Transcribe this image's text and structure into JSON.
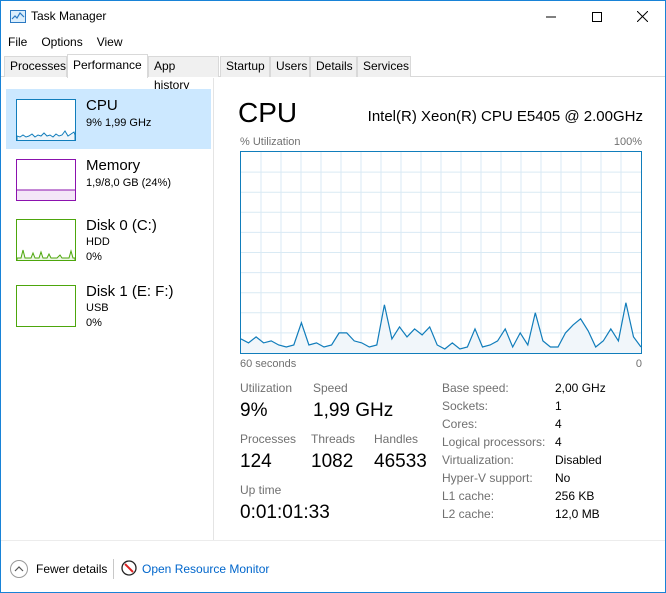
{
  "window": {
    "title": "Task Manager"
  },
  "menu": [
    "File",
    "Options",
    "View"
  ],
  "tabs": [
    "Processes",
    "Performance",
    "App history",
    "Startup",
    "Users",
    "Details",
    "Services"
  ],
  "sidebar": {
    "items": [
      {
        "name": "CPU",
        "line1": "9%  1,99 GHz",
        "line2": ""
      },
      {
        "name": "Memory",
        "line1": "1,9/8,0 GB (24%)",
        "line2": ""
      },
      {
        "name": "Disk 0 (C:)",
        "line1": "HDD",
        "line2": "0%"
      },
      {
        "name": "Disk 1 (E: F:)",
        "line1": "USB",
        "line2": "0%"
      }
    ]
  },
  "main": {
    "title": "CPU",
    "model": "Intel(R) Xeon(R) CPU E5405 @ 2.00GHz",
    "graph": {
      "y_label": "% Utilization",
      "y_max": "100%",
      "x_label_left": "60 seconds",
      "x_label_right": "0"
    },
    "stats": {
      "utilization_label": "Utilization",
      "utilization": "9%",
      "speed_label": "Speed",
      "speed": "1,99 GHz",
      "processes_label": "Processes",
      "processes": "124",
      "threads_label": "Threads",
      "threads": "1082",
      "handles_label": "Handles",
      "handles": "46533",
      "uptime_label": "Up time",
      "uptime": "0:01:01:33"
    },
    "details": [
      {
        "label": "Base speed:",
        "value": "2,00 GHz"
      },
      {
        "label": "Sockets:",
        "value": "1"
      },
      {
        "label": "Cores:",
        "value": "4"
      },
      {
        "label": "Logical processors:",
        "value": "4"
      },
      {
        "label": "Virtualization:",
        "value": "Disabled"
      },
      {
        "label": "Hyper-V support:",
        "value": "No"
      },
      {
        "label": "L1 cache:",
        "value": "256 KB"
      },
      {
        "label": "L2 cache:",
        "value": "12,0 MB"
      }
    ]
  },
  "footer": {
    "fewer_details": "Fewer details",
    "open_monitor": "Open Resource Monitor"
  },
  "chart_data": {
    "type": "area",
    "title": "",
    "ylim": [
      0,
      100
    ],
    "series": [
      {
        "values": [
          7,
          5,
          8,
          5,
          6,
          4,
          3,
          4,
          15,
          4,
          5,
          3,
          4,
          10,
          10,
          6,
          5,
          3,
          4,
          24,
          7,
          13,
          8,
          12,
          9,
          13,
          4,
          2,
          5,
          2,
          3,
          12,
          3,
          4,
          6,
          12,
          3,
          10,
          4,
          20,
          6,
          3,
          3,
          10,
          14,
          17,
          11,
          3,
          6,
          12,
          6,
          25,
          8,
          3
        ]
      }
    ],
    "colors": {
      "line": "#117dbb",
      "fill": "#f1f6fa",
      "grid": "#d9eaf4"
    }
  }
}
